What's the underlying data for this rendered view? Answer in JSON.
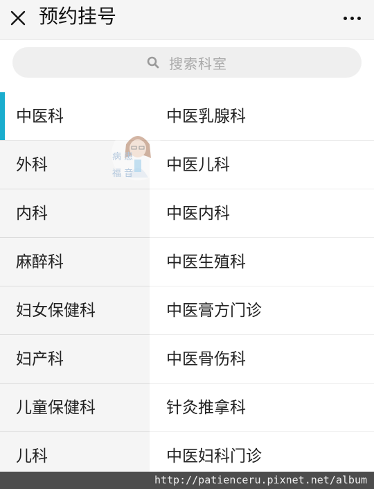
{
  "header": {
    "title": "预约挂号",
    "close_icon": "close-icon",
    "more_icon": "more-horizontal-icon"
  },
  "search": {
    "placeholder": "搜索科室",
    "icon": "search-icon"
  },
  "departments": {
    "active_index": 0,
    "accent_color": "#1aadce",
    "items": [
      {
        "label": "中医科"
      },
      {
        "label": "外科"
      },
      {
        "label": "内科"
      },
      {
        "label": "麻醉科"
      },
      {
        "label": "妇女保健科"
      },
      {
        "label": "妇产科"
      },
      {
        "label": "儿童保健科"
      },
      {
        "label": "儿科"
      }
    ]
  },
  "sub_departments": {
    "items": [
      {
        "label": "中医乳腺科"
      },
      {
        "label": "中医儿科"
      },
      {
        "label": "中医内科"
      },
      {
        "label": "中医生殖科"
      },
      {
        "label": "中医膏方门诊"
      },
      {
        "label": "中医骨伤科"
      },
      {
        "label": "针灸推拿科"
      },
      {
        "label": "中医妇科门诊"
      }
    ]
  },
  "watermark": {
    "text_line1": "病 患",
    "text_line2": "福 音"
  },
  "footer": {
    "url": "http://patienceru.pixnet.net/album"
  }
}
